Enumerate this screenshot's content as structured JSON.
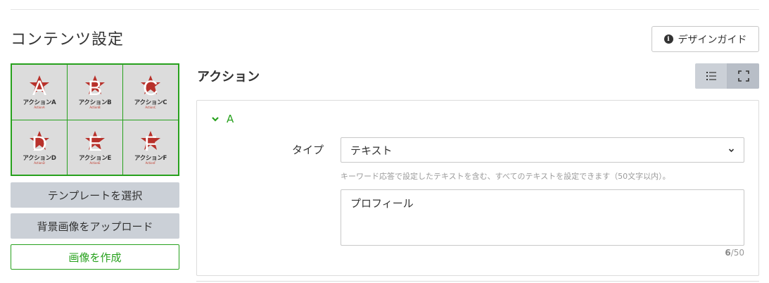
{
  "page": {
    "title": "コンテンツ設定"
  },
  "guide_button": {
    "label": "デザインガイド",
    "icon": "info-icon"
  },
  "template_grid": {
    "border_color": "#27a11d",
    "cells": [
      {
        "letter": "A",
        "label": "アクションA",
        "sub": "ActionA"
      },
      {
        "letter": "B",
        "label": "アクションB",
        "sub": "ActionB"
      },
      {
        "letter": "C",
        "label": "アクションC",
        "sub": "ActionC"
      },
      {
        "letter": "D",
        "label": "アクションD",
        "sub": "ActionD"
      },
      {
        "letter": "E",
        "label": "アクションE",
        "sub": "ActionE"
      },
      {
        "letter": "F",
        "label": "アクションF",
        "sub": "ActionF"
      }
    ]
  },
  "buttons": {
    "select_template": "テンプレートを選択",
    "upload_background": "背景画像をアップロード",
    "create_image": "画像を作成"
  },
  "action_section": {
    "title": "アクション",
    "view_toggle": {
      "list_icon": "list-icon",
      "expand_icon": "fullscreen-icon"
    },
    "item": {
      "name": "A",
      "type_label": "タイプ",
      "type_value": "テキスト",
      "hint": "キーワード応答で設定したテキストを含む、すべてのテキストを設定できます（50文字以内）。",
      "text_value": "プロフィール",
      "count_current": "6",
      "count_max": "/50"
    }
  },
  "colors": {
    "accent_green": "#27a11d",
    "button_gray": "#cbd0d7"
  }
}
